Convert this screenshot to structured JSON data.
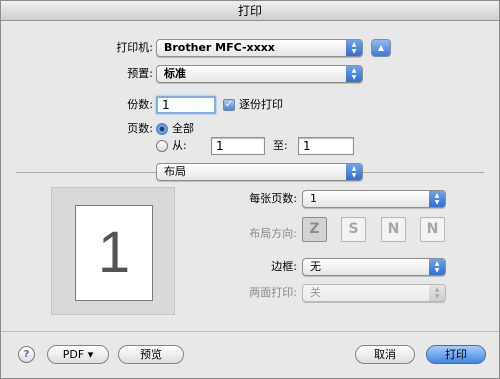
{
  "window": {
    "title": "打印"
  },
  "printer": {
    "label": "打印机:",
    "value": "Brother MFC-xxxx",
    "expand_icon": "triangle-up-icon"
  },
  "presets": {
    "label": "预置:",
    "value": "标准"
  },
  "copies": {
    "label": "份数:",
    "value": "1",
    "collated_label": "逐份打印",
    "collated": true
  },
  "pages": {
    "label": "页数:",
    "all_label": "全部",
    "from_label": "从:",
    "from_value": "1",
    "to_label": "至:",
    "to_value": "1",
    "selected": "all"
  },
  "panel": {
    "value": "布局"
  },
  "preview": {
    "page_number": "1"
  },
  "layout": {
    "pages_per_sheet_label": "每张页数:",
    "pages_per_sheet_value": "1",
    "direction_label": "布局方向:",
    "directions": [
      "Z",
      "S",
      "N",
      "N"
    ],
    "border_label": "边框:",
    "border_value": "无",
    "duplex_label": "两面打印:",
    "duplex_value": "关"
  },
  "footer": {
    "help": "?",
    "pdf_label": "PDF ▾",
    "preview_label": "预览",
    "cancel_label": "取消",
    "print_label": "打印"
  }
}
